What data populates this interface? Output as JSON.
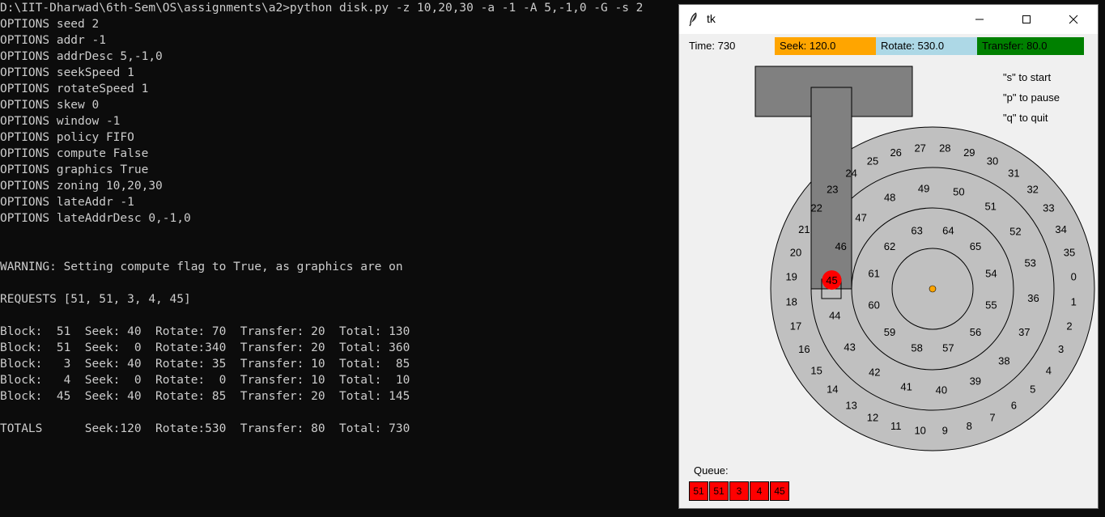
{
  "console": {
    "lines": [
      "D:\\IIT-Dharwad\\6th-Sem\\OS\\assignments\\a2>python disk.py -z 10,20,30 -a -1 -A 5,-1,0 -G -s 2",
      "OPTIONS seed 2",
      "OPTIONS addr -1",
      "OPTIONS addrDesc 5,-1,0",
      "OPTIONS seekSpeed 1",
      "OPTIONS rotateSpeed 1",
      "OPTIONS skew 0",
      "OPTIONS window -1",
      "OPTIONS policy FIFO",
      "OPTIONS compute False",
      "OPTIONS graphics True",
      "OPTIONS zoning 10,20,30",
      "OPTIONS lateAddr -1",
      "OPTIONS lateAddrDesc 0,-1,0",
      "",
      "",
      "WARNING: Setting compute flag to True, as graphics are on",
      "",
      "REQUESTS [51, 51, 3, 4, 45]",
      "",
      "Block:  51  Seek: 40  Rotate: 70  Transfer: 20  Total: 130",
      "Block:  51  Seek:  0  Rotate:340  Transfer: 20  Total: 360",
      "Block:   3  Seek: 40  Rotate: 35  Transfer: 10  Total:  85",
      "Block:   4  Seek:  0  Rotate:  0  Transfer: 10  Total:  10",
      "Block:  45  Seek: 40  Rotate: 85  Transfer: 20  Total: 145",
      "",
      "TOTALS      Seek:120  Rotate:530  Transfer: 80  Total: 730"
    ]
  },
  "window": {
    "title": "tk",
    "icon": "feather-icon",
    "minimize_icon": "minimize-icon",
    "maximize_icon": "maximize-icon",
    "close_icon": "close-icon"
  },
  "stats": {
    "time": "Time: 730",
    "seek": "Seek: 120.0",
    "rotate": "Rotate: 530.0",
    "transfer": "Transfer: 80.0"
  },
  "hints": [
    "\"s\" to start",
    "\"p\" to pause",
    "\"q\" to quit"
  ],
  "queue": {
    "label": "Queue:",
    "items": [
      "51",
      "51",
      "3",
      "4",
      "45"
    ]
  },
  "disk": {
    "outer_track": [
      "0",
      "1",
      "2",
      "3",
      "4",
      "5",
      "6",
      "7",
      "8",
      "9",
      "10",
      "11",
      "12",
      "13",
      "14",
      "15",
      "16",
      "17",
      "18",
      "19",
      "20",
      "21",
      "22",
      "23",
      "24",
      "25",
      "26",
      "27",
      "28",
      "29",
      "30",
      "31",
      "32",
      "33",
      "34",
      "35"
    ],
    "middle_track": [
      "36",
      "37",
      "38",
      "39",
      "40",
      "41",
      "42",
      "43",
      "44",
      "45",
      "46",
      "47",
      "48",
      "49",
      "50",
      "51",
      "52",
      "53"
    ],
    "inner_track": [
      "54",
      "55",
      "56",
      "57",
      "58",
      "59",
      "60",
      "61",
      "62",
      "63",
      "64",
      "65"
    ],
    "head_block": "45",
    "colors": {
      "platter": "#c0c0c0",
      "arm": "#808080",
      "head_block": "#ff0000",
      "spindle": "#ffa500"
    }
  }
}
